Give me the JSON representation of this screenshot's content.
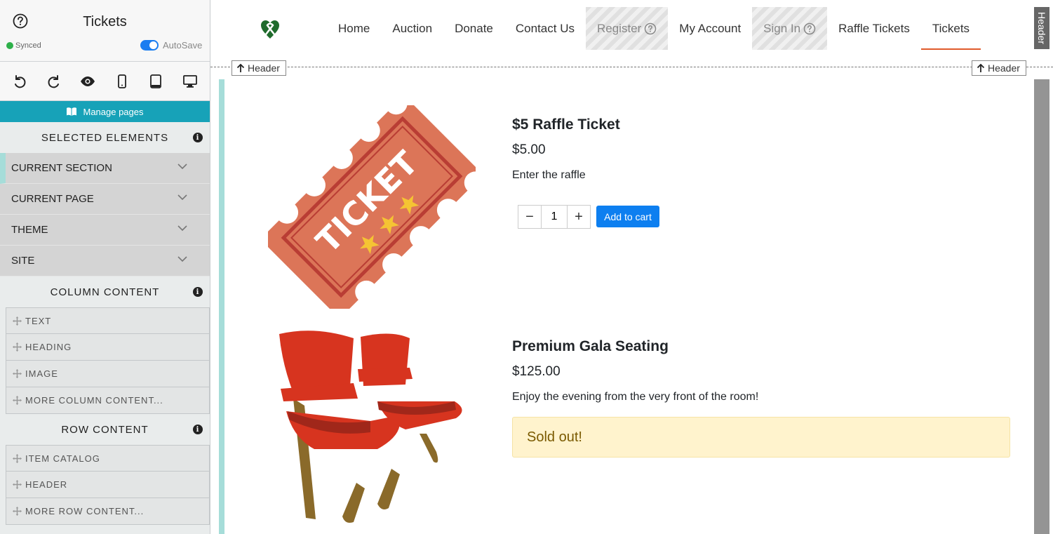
{
  "sidebar": {
    "title": "Tickets",
    "sync_status": "Synced",
    "autosave_label": "AutoSave",
    "autosave_on": true,
    "manage_pages_label": "Manage pages",
    "selected_elements": {
      "heading": "SELECTED ELEMENTS",
      "items": [
        {
          "label": "CURRENT SECTION"
        },
        {
          "label": "CURRENT PAGE"
        },
        {
          "label": "THEME"
        },
        {
          "label": "SITE"
        }
      ]
    },
    "column_content": {
      "heading": "COLUMN CONTENT",
      "items": [
        {
          "label": "TEXT"
        },
        {
          "label": "HEADING"
        },
        {
          "label": "IMAGE"
        },
        {
          "label": "MORE COLUMN CONTENT..."
        }
      ]
    },
    "row_content": {
      "heading": "ROW CONTENT",
      "items": [
        {
          "label": "ITEM CATALOG"
        },
        {
          "label": "HEADER"
        },
        {
          "label": "MORE ROW CONTENT..."
        }
      ]
    }
  },
  "site": {
    "nav": [
      {
        "label": "Home"
      },
      {
        "label": "Auction"
      },
      {
        "label": "Donate"
      },
      {
        "label": "Contact Us"
      },
      {
        "label": "Register"
      },
      {
        "label": "My Account"
      },
      {
        "label": "Sign In"
      },
      {
        "label": "Raffle Tickets"
      },
      {
        "label": "Tickets"
      }
    ],
    "header_tab": "Header",
    "section_tag_left": "Header",
    "section_tag_right": "Header",
    "items": [
      {
        "title": "$5 Raffle Ticket",
        "price": "$5.00",
        "description": "Enter the raffle",
        "quantity": "1",
        "add_to_cart": "Add to cart",
        "ticket_text": "TICKET"
      },
      {
        "title": "Premium Gala Seating",
        "price": "$125.00",
        "description": "Enjoy the evening from the very front of the room!",
        "status": "Sold out!"
      }
    ]
  },
  "colors": {
    "accent_teal": "#17a2b8",
    "active_underline": "#e05a2b",
    "button_blue": "#0d7ff0",
    "sold_out_bg": "#fff3cd"
  }
}
